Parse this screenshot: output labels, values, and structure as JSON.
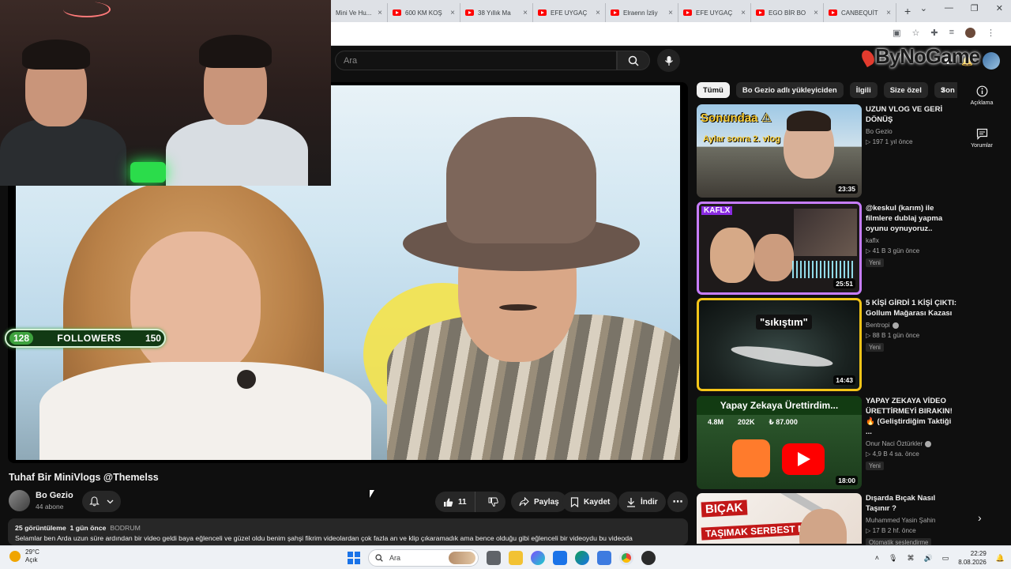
{
  "browser": {
    "tabs": [
      {
        "title": "Mini Ve Hu..."
      },
      {
        "title": "600 KM KOŞ"
      },
      {
        "title": "38 Yıllık Ma"
      },
      {
        "title": "EFE UYGAÇ"
      },
      {
        "title": "Elraenn İzliy"
      },
      {
        "title": "EFE UYGAÇ"
      },
      {
        "title": "EGO BİR BO"
      },
      {
        "title": "CANBEQUİT"
      }
    ],
    "new_tab": "+",
    "close_glyph": "×"
  },
  "header": {
    "search_placeholder": "Ara",
    "watermark": "ByNoGame"
  },
  "overlay": {
    "followers_current": "128",
    "followers_label": "FOLLOWERS",
    "followers_goal": "150"
  },
  "video": {
    "title": "Tuhaf Bir MiniVlogs @Themelss",
    "channel_name": "Bo Gezio",
    "channel_subs": "44 abone",
    "likes": "11",
    "share_label": "Paylaş",
    "save_label": "Kaydet",
    "download_label": "İndir",
    "description": {
      "views": "25 görüntüleme",
      "time": "1 gün önce",
      "location": "BODRUM",
      "text": "Selamlar ben Arda uzun süre ardından bir video geldi baya eğlenceli ve güzel oldu benim şahşi fikrim videolardan çok fazla an ve klip çıkaramadık ama bence olduğu gibi eğlenceli bir videoydu bu videoda"
    }
  },
  "chips": [
    "Tümü",
    "Bo Gezio adlı yükleyiciden",
    "İlgili",
    "Size özel",
    "Son"
  ],
  "recommendations": [
    {
      "title": "UZUN VLOG VE GERİ DÖNÜŞ",
      "channel": "Bo Gezio",
      "meta": "▷ 197  1 yıl önce",
      "duration": "23:35",
      "thumb_text1": "Sonundaa ⚠",
      "thumb_text2": "Aylar sonra 2. vlog",
      "badge": "",
      "verified": false
    },
    {
      "title": "@keskul (karım) ile filmlere dublaj yapma oyunu oynuyoruz..",
      "channel": "kaflx",
      "meta": "▷ 41 B  3 gün önce",
      "duration": "25:51",
      "thumb_text1": "KAFLX",
      "badge": "Yeni",
      "verified": false
    },
    {
      "title": "5 KİŞİ GİRDİ 1 KİŞİ ÇIKTI: Gollum Mağarası Kazası",
      "channel": "Bentropi",
      "meta": "▷ 88 B  1 gün önce",
      "duration": "14:43",
      "thumb_text1": "\"sıkıştım\"",
      "badge": "Yeni",
      "verified": true
    },
    {
      "title": "YAPAY ZEKAYA VİDEO ÜRETTİRMEYİ BIRAKIN! 🔥 (Geliştirdiğim Taktiği ...",
      "channel": "Onur Naci Öztürkler",
      "meta": "▷ 4,9 B  4 sa. önce",
      "duration": "18:00",
      "thumb_text1": "Yapay Zekaya Ürettirdim...",
      "stats": [
        "4.8M",
        "202K",
        "₺ 87.000"
      ],
      "badge": "Yeni",
      "verified": true
    },
    {
      "title": "Dışarda Bıçak Nasıl Taşınır ?",
      "channel": "Muhammed Yasin Şahin",
      "meta": "▷ 17 B  2 hf. önce",
      "duration": "",
      "thumb_text1": "BIÇAK",
      "thumb_text2": "TAŞIMAK SERBEST Mİ",
      "badge": "Otomatik seslendirme",
      "verified": false
    }
  ],
  "miniguide": [
    {
      "label": "Açıklama",
      "icon": "info-icon"
    },
    {
      "label": "Yorumlar",
      "icon": "comment-icon"
    }
  ],
  "taskbar": {
    "temp": "29°C",
    "weather": "Açık",
    "search": "Ara",
    "time": "22:29",
    "date": "8.08.2026"
  },
  "colors": {
    "bg": "#0f0f0f",
    "chip_active": "#f1f1f1",
    "yt_red": "#ff0000",
    "followers_green": "#3ea23e"
  }
}
